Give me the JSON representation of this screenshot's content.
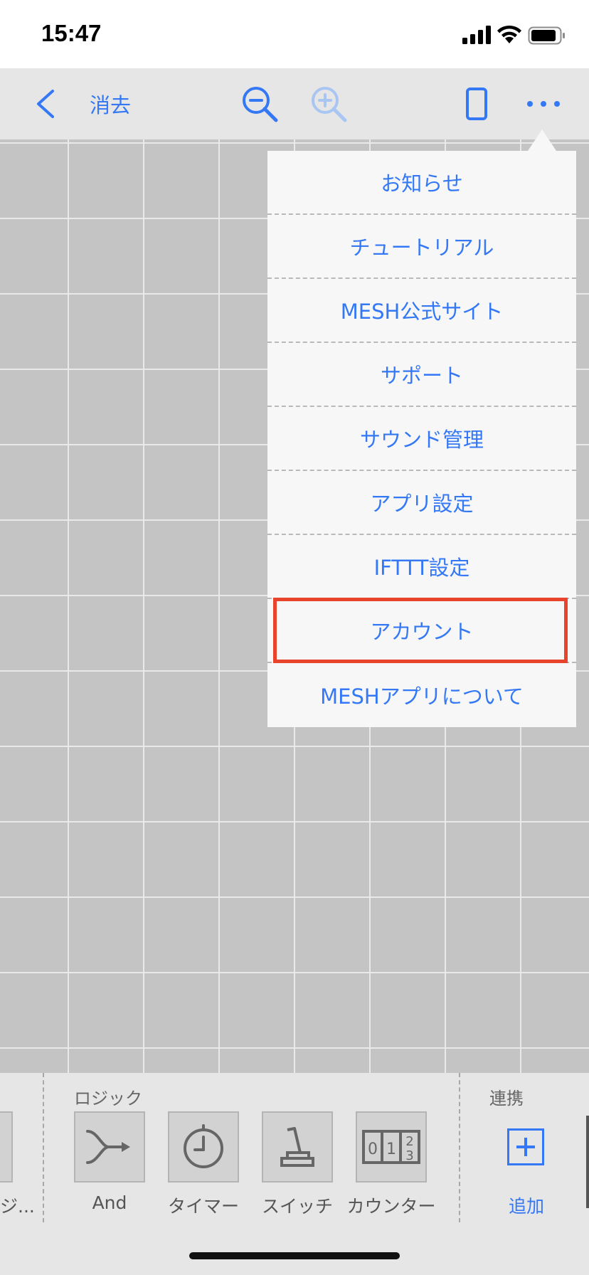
{
  "status_bar": {
    "time": "15:47"
  },
  "nav": {
    "clear_label": "消去",
    "icons": [
      "back-chevron",
      "zoom-out",
      "zoom-in",
      "device",
      "more"
    ]
  },
  "menu": {
    "items": [
      "お知らせ",
      "チュートリアル",
      "MESH公式サイト",
      "サポート",
      "サウンド管理",
      "アプリ設定",
      "IFTTT設定",
      "アカウント",
      "MESHアプリについて"
    ],
    "highlighted": "アカウント"
  },
  "palette": {
    "partial_label": "ジ...",
    "logic_title": "ロジック",
    "logic_items": [
      "And",
      "タイマー",
      "スイッチ",
      "カウンター"
    ],
    "link_title": "連携",
    "add_label": "追加"
  },
  "colors": {
    "accent": "#3478f6",
    "highlight_border": "#e8442c",
    "canvas": "#c4c4c4"
  }
}
